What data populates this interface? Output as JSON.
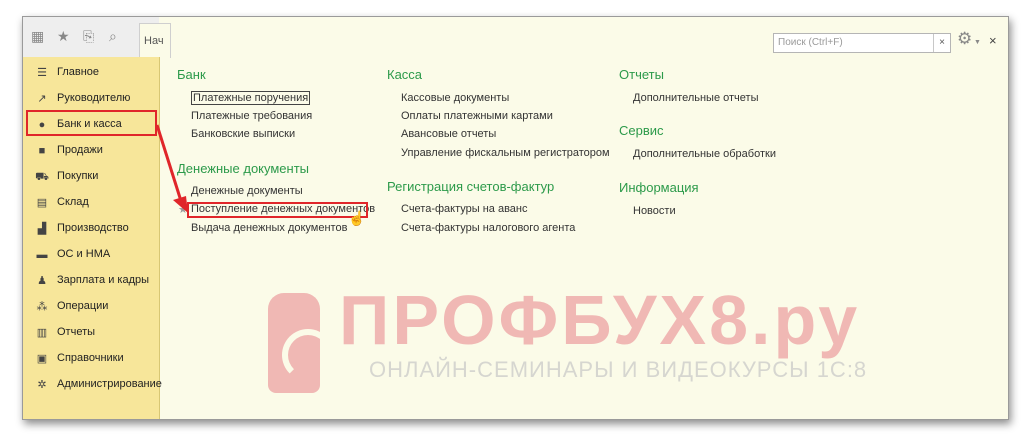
{
  "search": {
    "placeholder": "Поиск (Ctrl+F)",
    "clear_label": "×"
  },
  "close_label": "×",
  "tab": {
    "label": "Нач"
  },
  "sidebar": {
    "items": [
      {
        "label": "Главное",
        "icon": "menu-icon"
      },
      {
        "label": "Руководителю",
        "icon": "trend-icon"
      },
      {
        "label": "Банк и касса",
        "icon": "bank-icon"
      },
      {
        "label": "Продажи",
        "icon": "bag-icon"
      },
      {
        "label": "Покупки",
        "icon": "cart-icon"
      },
      {
        "label": "Склад",
        "icon": "warehouse-icon"
      },
      {
        "label": "Производство",
        "icon": "factory-icon"
      },
      {
        "label": "ОС и НМА",
        "icon": "truck-icon"
      },
      {
        "label": "Зарплата и кадры",
        "icon": "person-icon"
      },
      {
        "label": "Операции",
        "icon": "operations-icon"
      },
      {
        "label": "Отчеты",
        "icon": "bar-chart-icon"
      },
      {
        "label": "Справочники",
        "icon": "book-icon"
      },
      {
        "label": "Администрирование",
        "icon": "gear-icon"
      }
    ]
  },
  "sections": {
    "bank": {
      "title": "Банк",
      "links": [
        "Платежные поручения",
        "Платежные требования",
        "Банковские выписки"
      ]
    },
    "money_docs": {
      "title": "Денежные документы",
      "links": [
        "Денежные документы",
        "Поступление денежных документов",
        "Выдача денежных документов"
      ]
    },
    "kassa": {
      "title": "Касса",
      "links": [
        "Кассовые документы",
        "Оплаты платежными картами",
        "Авансовые отчеты",
        "Управление фискальным регистратором"
      ]
    },
    "invoices": {
      "title": "Регистрация счетов-фактур",
      "links": [
        "Счета-фактуры на аванс",
        "Счета-фактуры налогового агента"
      ]
    },
    "reports": {
      "title": "Отчеты",
      "links": [
        "Дополнительные отчеты"
      ]
    },
    "service": {
      "title": "Сервис",
      "links": [
        "Дополнительные обработки"
      ]
    },
    "info": {
      "title": "Информация",
      "links": [
        "Новости"
      ]
    }
  },
  "watermark": {
    "title": "ПРОФБУХ8.ру",
    "subtitle": "ОНЛАЙН-СЕМИНАРЫ И ВИДЕОКУРСЫ 1С:8"
  },
  "colors": {
    "section_title": "#2c9a4a",
    "sidebar_bg": "#f7e69a",
    "panel_bg": "#fbfbe8",
    "highlight": "#e0262a"
  }
}
